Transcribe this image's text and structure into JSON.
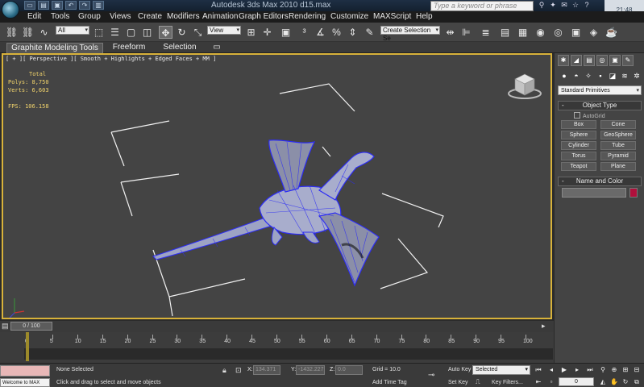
{
  "titlebar": {
    "title": "Autodesk 3ds Max 2010     d15.max",
    "search_placeholder": "Type a keyword or phrase",
    "clock": "21:48"
  },
  "menu": [
    "Edit",
    "Tools",
    "Group",
    "Views",
    "Create",
    "Modifiers",
    "Animation",
    "Graph Editors",
    "Rendering",
    "Customize",
    "MAXScript",
    "Help"
  ],
  "toolbar": {
    "selection_filter": "All",
    "reference_coord": "View",
    "named_selection": "Create Selection Se"
  },
  "ribbon": {
    "tabs": [
      "Graphite Modeling Tools",
      "Freeform",
      "Selection"
    ]
  },
  "viewport": {
    "label": "[ + ][ Perspective ][ Smooth + Highlights + Edged Faces + MM ]",
    "stats_total": "Total",
    "polys": "Polys: 8,750",
    "verts": "Verts: 6,603",
    "fps": "FPS:   106.158"
  },
  "command_panel": {
    "primitive_type": "Standard Primitives",
    "object_type_title": "Object Type",
    "autogrid": "AutoGrid",
    "buttons": [
      "Box",
      "Cone",
      "Sphere",
      "GeoSphere",
      "Cylinder",
      "Tube",
      "Torus",
      "Pyramid",
      "Teapot",
      "Plane"
    ],
    "name_color_title": "Name and Color",
    "object_color": "#b0103c"
  },
  "timeline": {
    "slider_label": "0 / 100",
    "current_frame": 0,
    "ticks": [
      0,
      5,
      10,
      15,
      20,
      25,
      30,
      35,
      40,
      45,
      50,
      55,
      60,
      65,
      70,
      75,
      80,
      85,
      90,
      95,
      100
    ]
  },
  "status": {
    "selection": "None Selected",
    "prompt": "Click and drag to select and move objects",
    "x_label": "X:",
    "x_value": "134.371",
    "y_label": "Y:",
    "y_value": "-1432.227",
    "z_label": "Z:",
    "z_value": "0.0",
    "grid": "Grid = 10.0",
    "add_time_tag": "Add Time Tag",
    "auto_key": "Auto Key",
    "set_key": "Set Key",
    "key_mode": "Selected",
    "key_filters": "Key Filters...",
    "frame_value": "0",
    "listener": "Welcome to MAX"
  },
  "colors": {
    "viewport_border": "#d8b23a",
    "wire": "#3d3dff",
    "stats": "#f1d36b"
  }
}
